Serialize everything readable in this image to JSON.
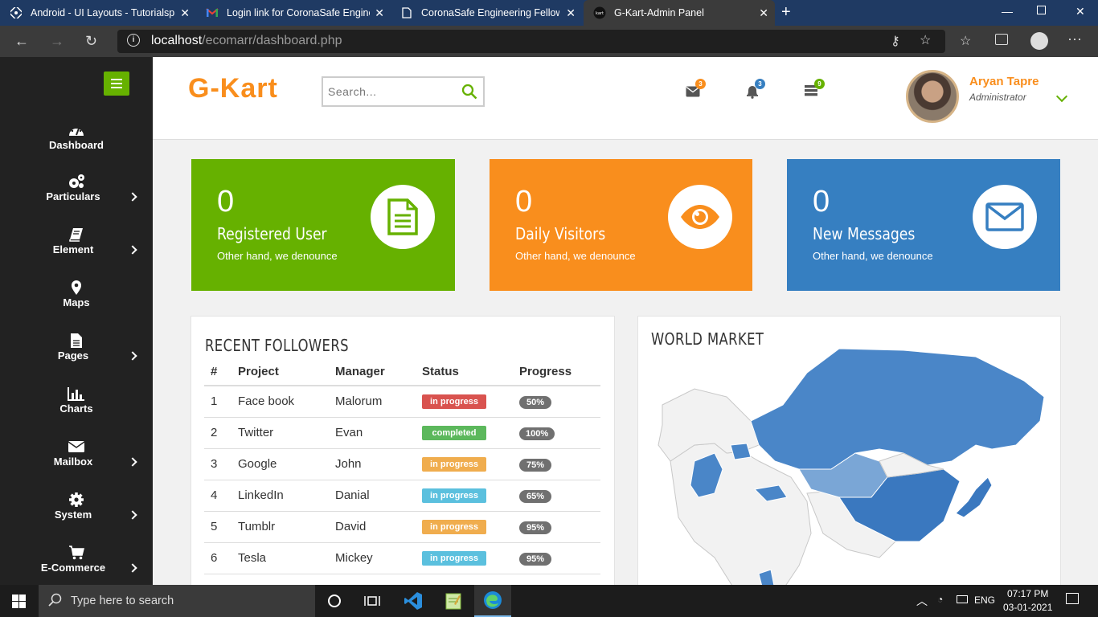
{
  "browser": {
    "tabs": [
      {
        "title": "Android - UI Layouts - Tutorialsp",
        "favicon": "tutorialspoint-icon",
        "active": false
      },
      {
        "title": "Login link for CoronaSafe Engine",
        "favicon": "gmail-icon",
        "active": false
      },
      {
        "title": "CoronaSafe Engineering Fellowsh",
        "favicon": "document-icon",
        "active": false
      },
      {
        "title": "G-Kart-Admin Panel",
        "favicon": "gkart-icon",
        "active": true
      }
    ],
    "url_host": "localhost",
    "url_path": "/ecomarr/dashboard.php"
  },
  "sidebar": {
    "items": [
      {
        "label": "Dashboard",
        "icon": "dashboard-icon",
        "has_submenu": false
      },
      {
        "label": "Particulars",
        "icon": "gears-icon",
        "has_submenu": true
      },
      {
        "label": "Element",
        "icon": "book-icon",
        "has_submenu": true
      },
      {
        "label": "Maps",
        "icon": "map-marker-icon",
        "has_submenu": false
      },
      {
        "label": "Pages",
        "icon": "file-icon",
        "has_submenu": true
      },
      {
        "label": "Charts",
        "icon": "bar-chart-icon",
        "has_submenu": false
      },
      {
        "label": "Mailbox",
        "icon": "envelope-icon",
        "has_submenu": true
      },
      {
        "label": "System",
        "icon": "gear-icon",
        "has_submenu": true
      },
      {
        "label": "E-Commerce",
        "icon": "cart-icon",
        "has_submenu": true
      }
    ]
  },
  "header": {
    "logo": "G-Kart",
    "search_placeholder": "Search...",
    "notifications": {
      "messages": "3",
      "alerts": "3",
      "tasks": "9"
    },
    "user": {
      "name": "Aryan Tapre",
      "role": "Administrator"
    }
  },
  "cards": [
    {
      "value": "0",
      "title": "Registered User",
      "subtitle": "Other hand, we denounce",
      "color": "#66b100",
      "icon": "file-text-icon"
    },
    {
      "value": "0",
      "title": "Daily Visitors",
      "subtitle": "Other hand, we denounce",
      "color": "#f98e1d",
      "icon": "eye-icon"
    },
    {
      "value": "0",
      "title": "New Messages",
      "subtitle": "Other hand, we denounce",
      "color": "#367fc1",
      "icon": "envelope-icon"
    }
  ],
  "followers": {
    "title": "RECENT FOLLOWERS",
    "columns": [
      "#",
      "Project",
      "Manager",
      "Status",
      "Progress"
    ],
    "rows": [
      {
        "n": "1",
        "project": "Face book",
        "manager": "Malorum",
        "status": "in progress",
        "status_color": "#d9534f",
        "progress": "50%"
      },
      {
        "n": "2",
        "project": "Twitter",
        "manager": "Evan",
        "status": "completed",
        "status_color": "#5cb85c",
        "progress": "100%"
      },
      {
        "n": "3",
        "project": "Google",
        "manager": "John",
        "status": "in progress",
        "status_color": "#f0ad4e",
        "progress": "75%"
      },
      {
        "n": "4",
        "project": "LinkedIn",
        "manager": "Danial",
        "status": "in progress",
        "status_color": "#5bc0de",
        "progress": "65%"
      },
      {
        "n": "5",
        "project": "Tumblr",
        "manager": "David",
        "status": "in progress",
        "status_color": "#f0ad4e",
        "progress": "95%"
      },
      {
        "n": "6",
        "project": "Tesla",
        "manager": "Mickey",
        "status": "in progress",
        "status_color": "#5bc0de",
        "progress": "95%"
      }
    ]
  },
  "world_market": {
    "title": "WORLD MARKET"
  },
  "taskbar": {
    "search_placeholder": "Type here to search",
    "language": "ENG",
    "time": "07:17 PM",
    "date": "03-01-2021"
  }
}
